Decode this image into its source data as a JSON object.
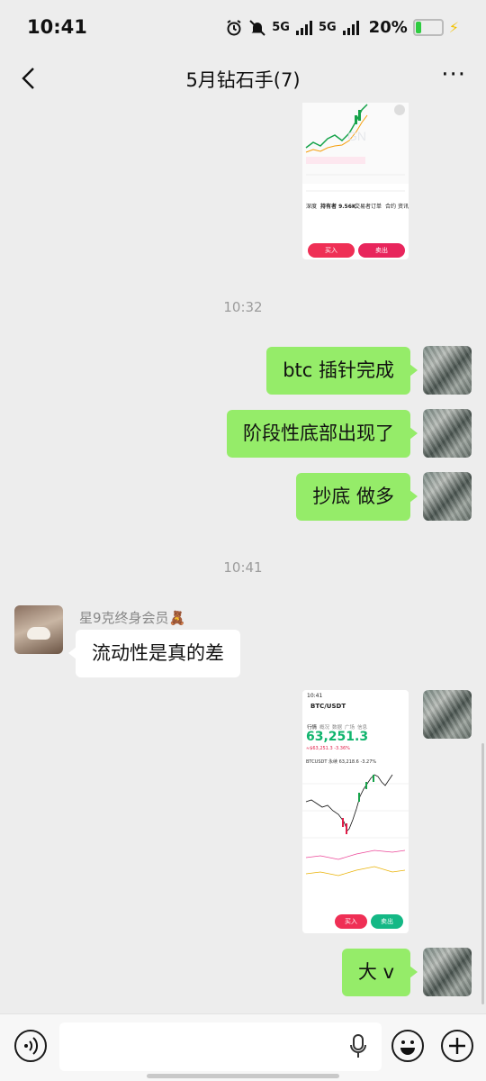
{
  "status_bar": {
    "time": "10:41",
    "signal1": "5G",
    "signal2": "5G",
    "battery_pct": "20%",
    "icons": [
      "alarm-icon",
      "mute-icon",
      "signal-icon",
      "battery-icon"
    ]
  },
  "nav": {
    "title": "5月钻石手(7)",
    "more": "···"
  },
  "messages": {
    "time_1": "10:32",
    "msg_1": "btc 插针完成",
    "msg_2": "阶段性底部出现了",
    "msg_3": "抄底 做多",
    "time_2": "10:41",
    "sender_name": "星9克终身会员🧸",
    "msg_4": "流动性是真的差",
    "msg_5": "大 v"
  },
  "screenshot_top": {
    "tabs": [
      "深度",
      "持有者 9.56K",
      "交易者",
      "订单",
      "合约",
      "资讯"
    ],
    "buy": "买入",
    "sell": "卖出"
  },
  "screenshot_bottom": {
    "time": "10:41",
    "pair": "BTC/USDT",
    "tabs": [
      "行情",
      "概况",
      "数据",
      "广场",
      "信息"
    ],
    "price": "63,251.3",
    "sub_price": "≈$63,251.3  -3.36%",
    "perp_label": "BTCUSDT 永续 63,218.6 -3.27%",
    "buy": "买入",
    "sell": "卖出"
  },
  "colors": {
    "self_bubble": "#95ec69",
    "background": "#ededed",
    "buy": "#ef2f55",
    "sell": "#14b885"
  }
}
